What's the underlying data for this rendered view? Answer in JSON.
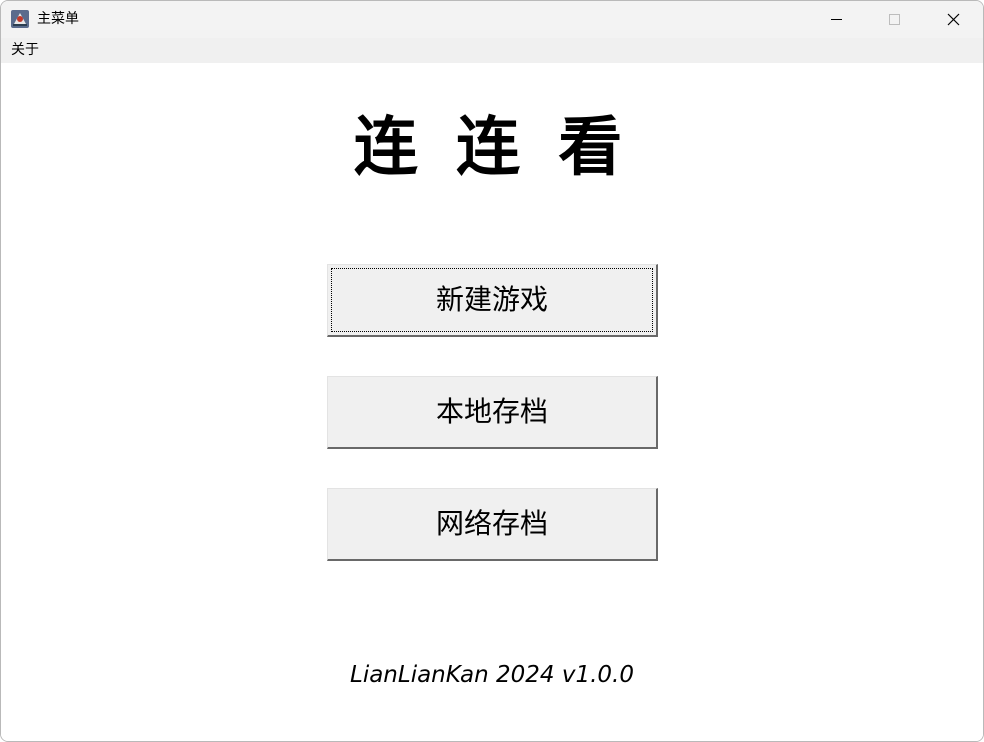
{
  "window": {
    "title": "主菜单",
    "app_icon": "java-cup-icon",
    "controls": [
      "minimize-icon",
      "maximize-icon",
      "close-icon"
    ]
  },
  "menubar": {
    "items": [
      {
        "label": "关于"
      }
    ]
  },
  "main": {
    "game_title": "连 连 看",
    "buttons": [
      {
        "label": "新建游戏",
        "focused": true
      },
      {
        "label": "本地存档",
        "focused": false
      },
      {
        "label": "网络存档",
        "focused": false
      }
    ],
    "version_text": "LianLianKan 2024 v1.0.0"
  },
  "colors": {
    "titlebar_bg": "#f3f3f3",
    "menubar_bg": "#f0f0f0",
    "button_bg": "#f0f0f0",
    "button_shadow": "#696969",
    "content_bg": "#ffffff"
  }
}
